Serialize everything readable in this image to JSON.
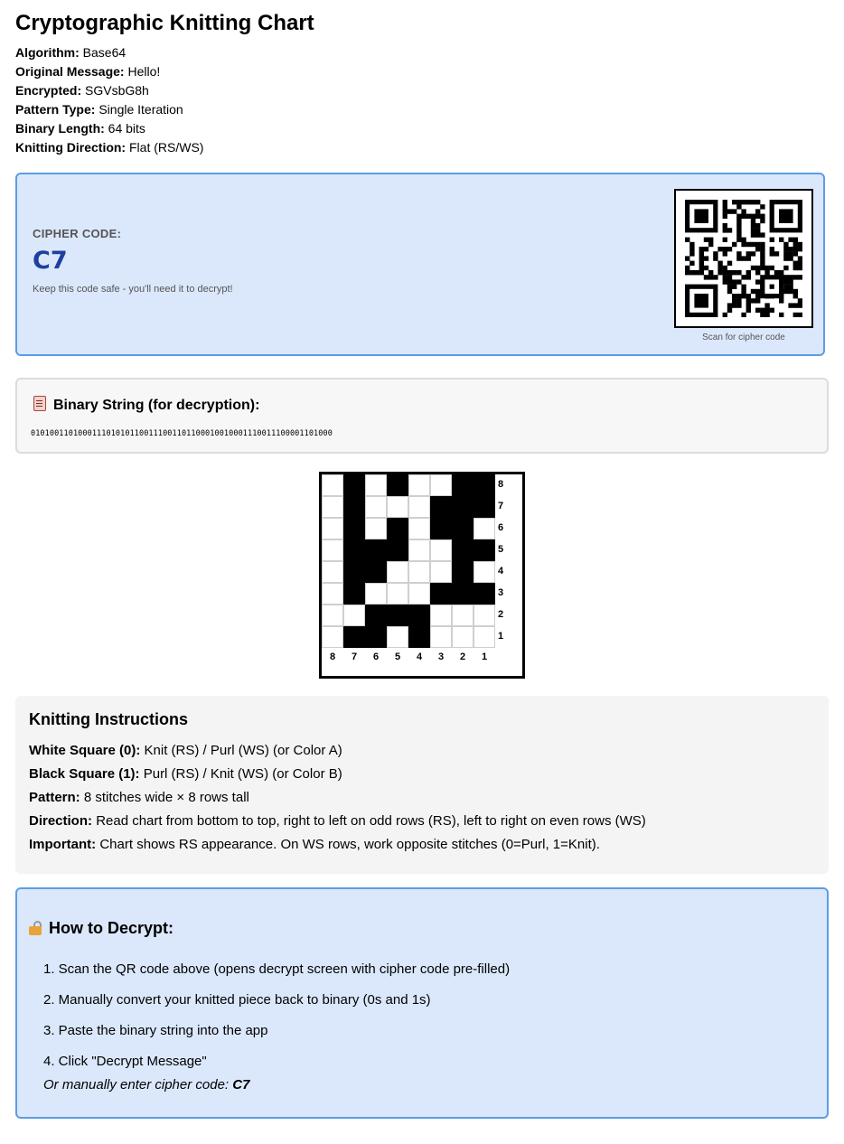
{
  "title": "Cryptographic Knitting Chart",
  "meta": [
    {
      "label": "Algorithm:",
      "value": "Base64"
    },
    {
      "label": "Original Message:",
      "value": "Hello!"
    },
    {
      "label": "Encrypted:",
      "value": "SGVsbG8h"
    },
    {
      "label": "Pattern Type:",
      "value": "Single Iteration"
    },
    {
      "label": "Binary Length:",
      "value": "64 bits"
    },
    {
      "label": "Knitting Direction:",
      "value": "Flat (RS/WS)"
    }
  ],
  "cipher": {
    "label": "CIPHER CODE:",
    "code": "C7",
    "note": "Keep this code safe - you'll need it to decrypt!",
    "qr_caption": "Scan for cipher code"
  },
  "binary": {
    "title": "Binary String (for decryption):",
    "icon": "clipboard-icon",
    "value": "0101001101000111010101100111001101100010010001110011100001101000"
  },
  "chart": {
    "rows_top_to_bottom": [
      [
        0,
        1,
        0,
        1,
        0,
        0,
        1,
        1
      ],
      [
        0,
        1,
        0,
        0,
        0,
        1,
        1,
        1
      ],
      [
        0,
        1,
        0,
        1,
        0,
        1,
        1,
        0
      ],
      [
        0,
        1,
        1,
        1,
        0,
        0,
        1,
        1
      ],
      [
        0,
        1,
        1,
        0,
        0,
        0,
        1,
        0
      ],
      [
        0,
        1,
        0,
        0,
        0,
        1,
        1,
        1
      ],
      [
        0,
        0,
        1,
        1,
        1,
        0,
        0,
        0
      ],
      [
        0,
        1,
        1,
        0,
        1,
        0,
        0,
        0
      ]
    ],
    "row_labels_top_to_bottom": [
      "8",
      "7",
      "6",
      "5",
      "4",
      "3",
      "2",
      "1"
    ],
    "col_labels": [
      "8",
      "7",
      "6",
      "5",
      "4",
      "3",
      "2",
      "1"
    ]
  },
  "instructions": {
    "title": "Knitting Instructions",
    "lines": [
      {
        "label": "White Square (0):",
        "text": "Knit (RS) / Purl (WS) (or Color A)"
      },
      {
        "label": "Black Square (1):",
        "text": "Purl (RS) / Knit (WS) (or Color B)"
      },
      {
        "label": "Pattern:",
        "text": "8 stitches wide × 8 rows tall"
      },
      {
        "label": "Direction:",
        "text": "Read chart from bottom to top, right to left on odd rows (RS), left to right on even rows (WS)"
      },
      {
        "label": "Important:",
        "text": "Chart shows RS appearance. On WS rows, work opposite stitches (0=Purl, 1=Knit)."
      }
    ]
  },
  "decrypt": {
    "title": "How to Decrypt:",
    "icon": "unlock-icon",
    "steps": [
      "1. Scan the QR code above (opens decrypt screen with cipher code pre-filled)",
      "2. Manually convert your knitted piece back to binary (0s and 1s)",
      "3. Paste the binary string into the app",
      "4. Click \"Decrypt Message\""
    ],
    "foot_text": "Or manually enter cipher code:",
    "foot_code": "C7"
  }
}
